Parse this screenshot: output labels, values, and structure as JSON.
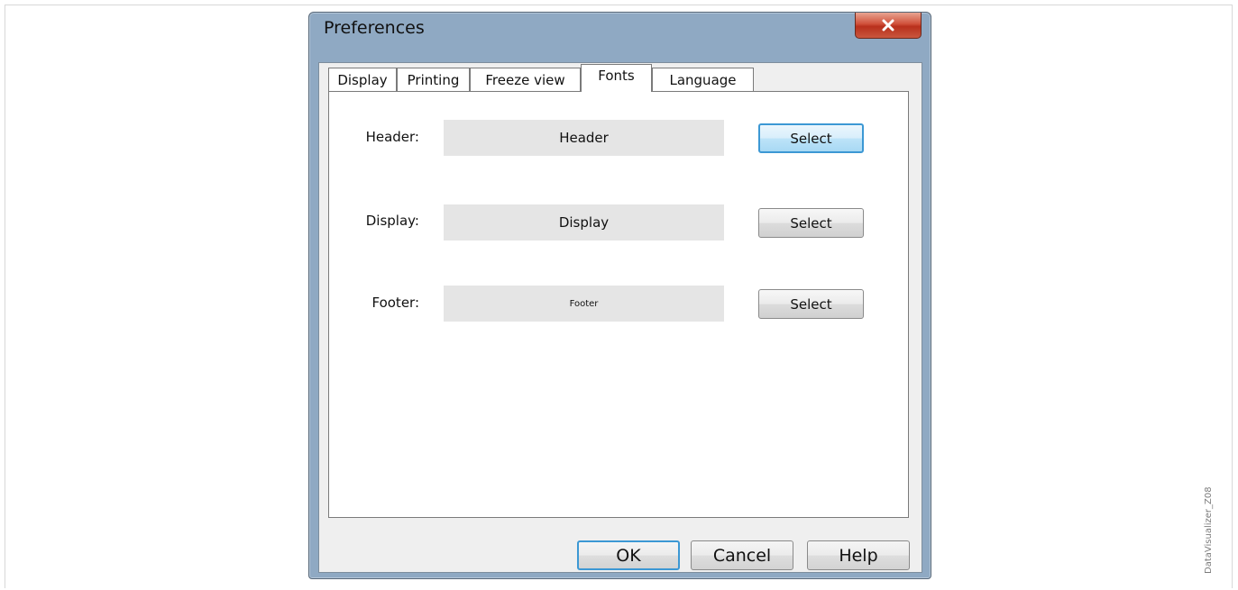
{
  "dialog": {
    "title": "Preferences",
    "close_icon": "close-icon"
  },
  "tabs": [
    {
      "label": "Display"
    },
    {
      "label": "Printing"
    },
    {
      "label": "Freeze view"
    },
    {
      "label": "Fonts",
      "active": true
    },
    {
      "label": "Language"
    }
  ],
  "fonts": {
    "header": {
      "label": "Header:",
      "preview": "Header",
      "select_label": "Select"
    },
    "display": {
      "label": "Display:",
      "preview": "Display",
      "select_label": "Select"
    },
    "footer": {
      "label": "Footer:",
      "preview": "Footer",
      "select_label": "Select"
    }
  },
  "buttons": {
    "ok": "OK",
    "cancel": "Cancel",
    "help": "Help"
  },
  "caption": "DataVisualizer_Z08",
  "colors": {
    "title_bar": "#8fa9c3",
    "close_button": "#c9573e",
    "focus_border": "#3c98d4",
    "preview_background": "#e5e5e5"
  }
}
